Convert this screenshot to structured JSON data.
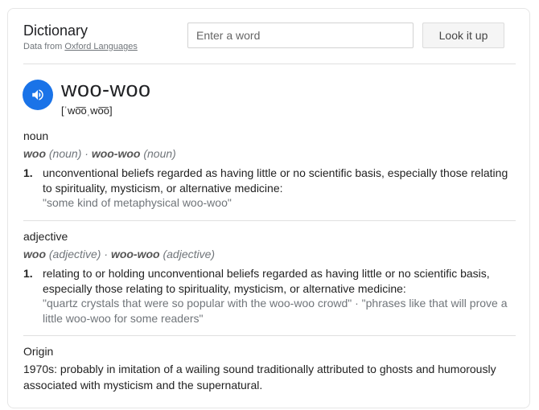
{
  "header": {
    "title": "Dictionary",
    "source_prefix": "Data from ",
    "source_link": "Oxford Languages"
  },
  "search": {
    "placeholder": "Enter a word",
    "value": ""
  },
  "lookup_button": "Look it up",
  "entry": {
    "word": "woo-woo",
    "phonetic": "[ˈwo͞oˌwo͞o]",
    "speaker_icon": "speaker-icon",
    "accent_color": "#1a73e8"
  },
  "senses": [
    {
      "pos": "noun",
      "form1": "woo",
      "form1_pos": "(noun)",
      "sep": " · ",
      "form2": "woo-woo",
      "form2_pos": "(noun)",
      "number": "1.",
      "definition": "unconventional beliefs regarded as having little or no scientific basis, especially those relating to spirituality, mysticism, or alternative medicine:",
      "example": "\"some kind of metaphysical woo-woo\""
    },
    {
      "pos": "adjective",
      "form1": "woo",
      "form1_pos": "(adjective)",
      "sep": " · ",
      "form2": "woo-woo",
      "form2_pos": "(adjective)",
      "number": "1.",
      "definition": "relating to or holding unconventional beliefs regarded as having little or no scientific basis, especially those relating to spirituality, mysticism, or alternative medicine:",
      "example": "\"quartz crystals that were so popular with the woo-woo crowd\" · \"phrases like that will prove a little woo-woo for some readers\""
    }
  ],
  "origin": {
    "heading": "Origin",
    "text": "1970s: probably in imitation of a wailing sound traditionally attributed to ghosts and humorously associated with mysticism and the supernatural."
  }
}
